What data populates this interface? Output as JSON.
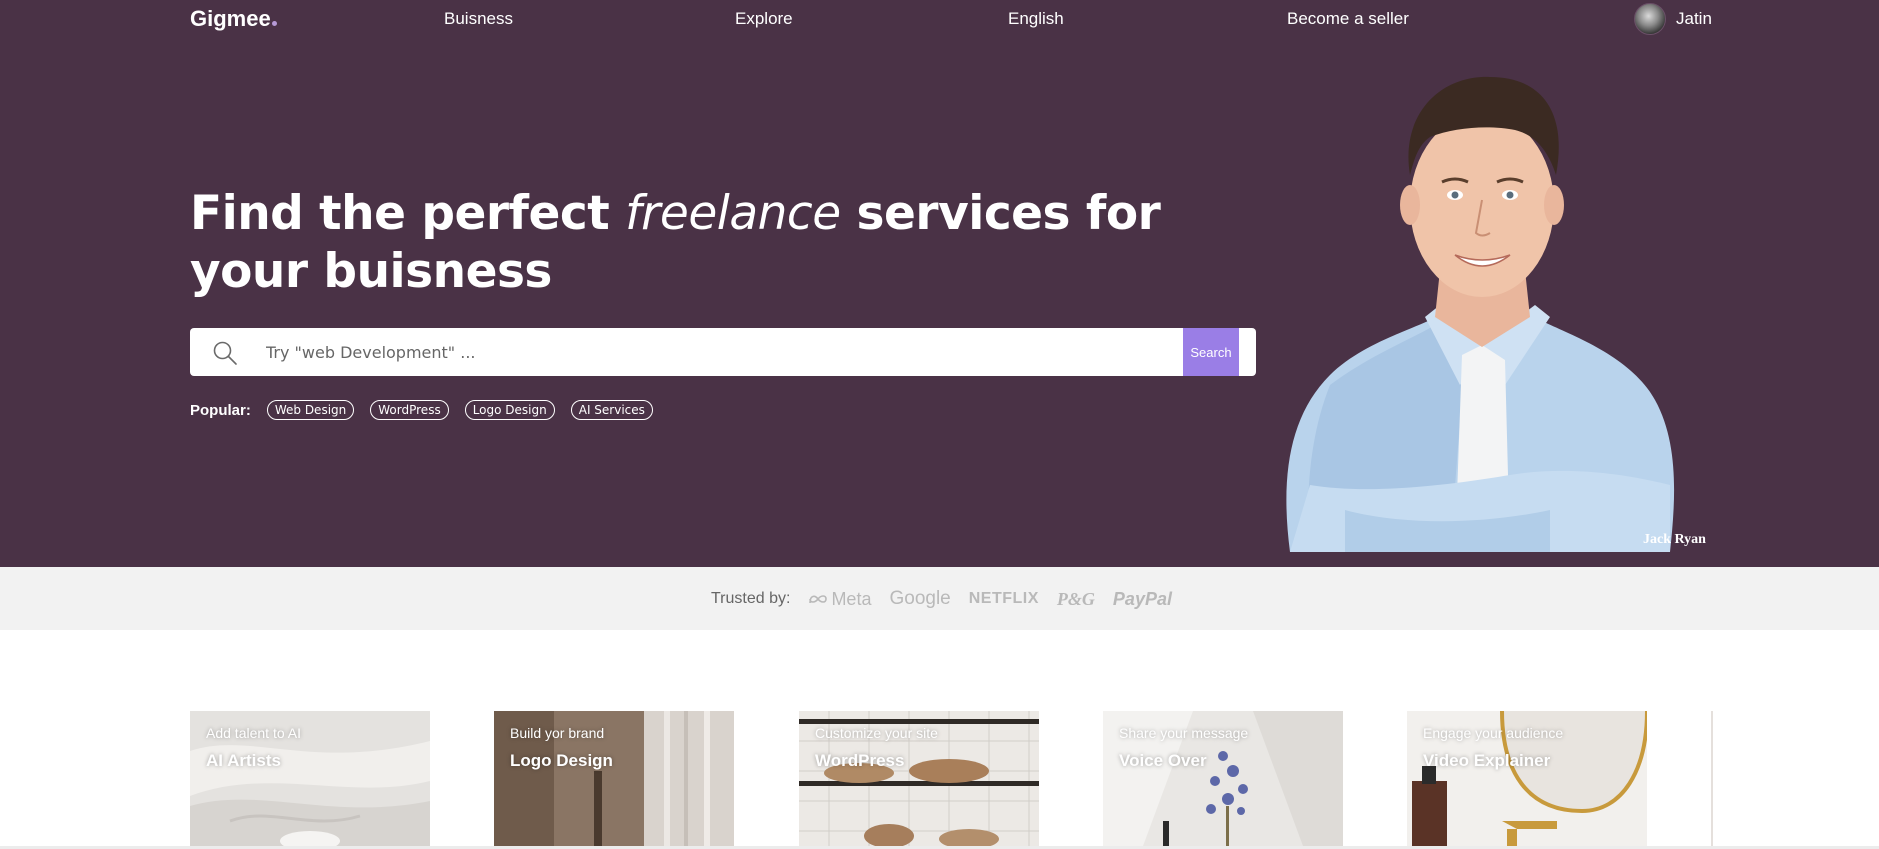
{
  "nav": {
    "logo": "Gigmee",
    "links": [
      "Buisness",
      "Explore",
      "English",
      "Become a seller"
    ],
    "user_name": "Jatin"
  },
  "hero": {
    "headline_before": "Find the perfect ",
    "headline_em": "freelance",
    "headline_after": " services for your buisness",
    "search_placeholder": "Try \"web Development\" ...",
    "search_button": "Search",
    "popular_label": "Popular:",
    "popular_tags": [
      "Web Design",
      "WordPress",
      "Logo Design",
      "AI Services"
    ],
    "person_caption": "Jack Ryan"
  },
  "trusted": {
    "label": "Trusted by:",
    "brands": [
      "Meta",
      "Google",
      "NETFLIX",
      "P&G",
      "PayPal"
    ]
  },
  "cards": [
    {
      "subtitle": "Add talent to AI",
      "title": "AI Artists"
    },
    {
      "subtitle": "Build yor brand",
      "title": "Logo Design"
    },
    {
      "subtitle": "Customize your site",
      "title": "WordPress"
    },
    {
      "subtitle": "Share your message",
      "title": "Voice Over"
    },
    {
      "subtitle": "Engage your audience",
      "title": "Video Explainer"
    }
  ],
  "colors": {
    "hero_bg": "#4a3246",
    "accent": "#9a7ee6",
    "trusted_bg": "#f2f2f2"
  },
  "icons": [
    "search-icon",
    "meta-logo-icon"
  ]
}
